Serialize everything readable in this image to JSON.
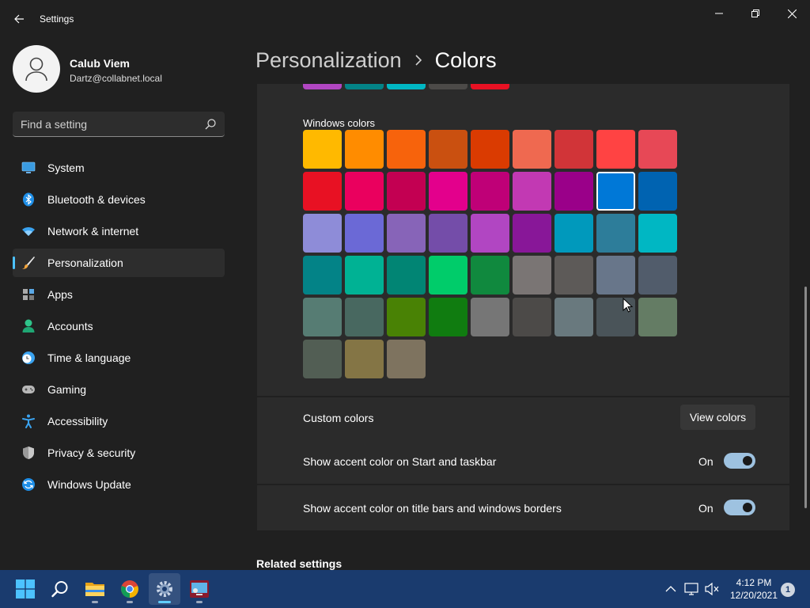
{
  "window": {
    "title": "Settings"
  },
  "profile": {
    "name": "Calub Viem",
    "email": "Dartz@collabnet.local"
  },
  "search": {
    "placeholder": "Find a setting"
  },
  "nav": [
    {
      "label": "System",
      "icon": "monitor-icon"
    },
    {
      "label": "Bluetooth & devices",
      "icon": "bluetooth-icon"
    },
    {
      "label": "Network & internet",
      "icon": "wifi-icon"
    },
    {
      "label": "Personalization",
      "icon": "brush-icon",
      "active": true
    },
    {
      "label": "Apps",
      "icon": "apps-icon"
    },
    {
      "label": "Accounts",
      "icon": "person-icon"
    },
    {
      "label": "Time & language",
      "icon": "clock-globe-icon"
    },
    {
      "label": "Gaming",
      "icon": "gamepad-icon"
    },
    {
      "label": "Accessibility",
      "icon": "accessibility-icon"
    },
    {
      "label": "Privacy & security",
      "icon": "shield-icon"
    },
    {
      "label": "Windows Update",
      "icon": "update-icon"
    }
  ],
  "breadcrumb": {
    "parent": "Personalization",
    "current": "Colors"
  },
  "recent_colors": [
    "#b146c2",
    "#038387",
    "#00b7c3",
    "#4c4a48",
    "#e81123"
  ],
  "windows_colors": {
    "label": "Windows colors",
    "rows": [
      [
        "#ffb900",
        "#ff8c00",
        "#f7630c",
        "#ca5010",
        "#da3b01",
        "#ef6950",
        "#d13438",
        "#ff4343",
        "#e74856"
      ],
      [
        "#e81123",
        "#ea005e",
        "#c30052",
        "#e3008c",
        "#bf0077",
        "#c239b3",
        "#9a0089",
        "#0078d7",
        "#0063b1"
      ],
      [
        "#8e8cd8",
        "#6b69d6",
        "#8764b8",
        "#744da9",
        "#b146c2",
        "#881798",
        "#0099bc",
        "#2d7d9a",
        "#00b7c3"
      ],
      [
        "#038387",
        "#00b294",
        "#018574",
        "#00cc6a",
        "#10893e",
        "#7a7574",
        "#5d5a58",
        "#68768a",
        "#515c6b"
      ],
      [
        "#567c73",
        "#486860",
        "#498205",
        "#107c10",
        "#767676",
        "#4c4a48",
        "#69797e",
        "#4a5459",
        "#647c64"
      ],
      [
        "#525e54",
        "#847545",
        "#7e735f"
      ]
    ],
    "selected": "#0078d7"
  },
  "custom_colors": {
    "label": "Custom colors",
    "button": "View colors"
  },
  "settings": [
    {
      "label": "Show accent color on Start and taskbar",
      "state": "On"
    },
    {
      "label": "Show accent color on title bars and windows borders",
      "state": "On"
    }
  ],
  "related": {
    "label": "Related settings"
  },
  "taskbar": {
    "time": "4:12 PM",
    "date": "12/20/2021",
    "notifications": "1"
  }
}
